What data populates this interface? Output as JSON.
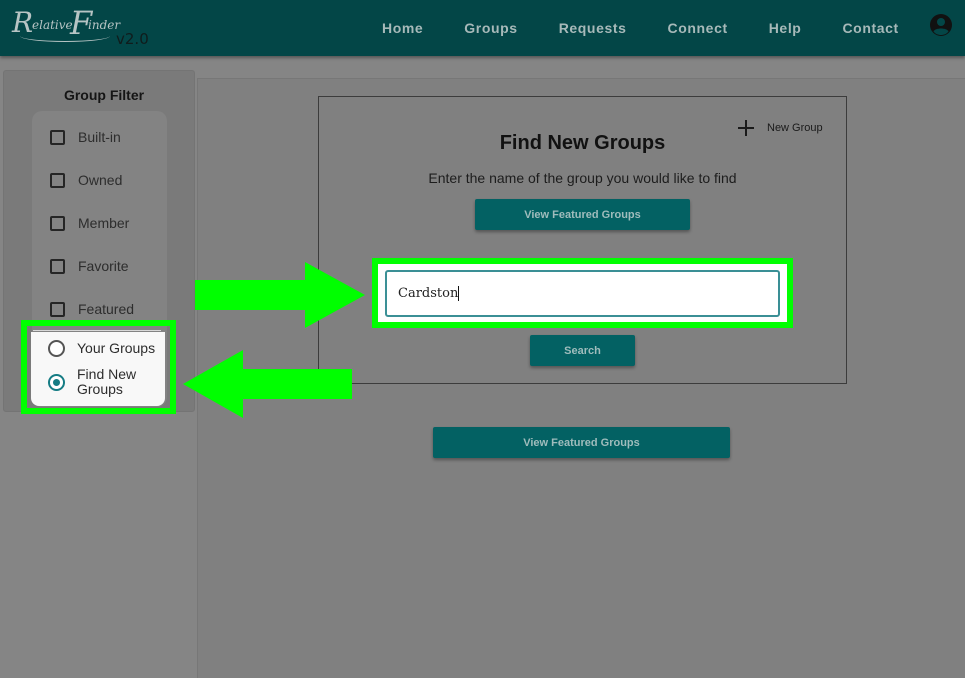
{
  "header": {
    "logo_r": "R",
    "logo_elative": "elative",
    "logo_f": "F",
    "logo_inder": "inder",
    "version": "v2.0",
    "nav": [
      "Home",
      "Groups",
      "Requests",
      "Connect",
      "Help",
      "Contact"
    ],
    "user_icon": "account-circle-icon"
  },
  "sidebar": {
    "title": "Group Filter",
    "checkboxes": [
      "Built-in",
      "Owned",
      "Member",
      "Favorite",
      "Featured"
    ],
    "radios": [
      {
        "label": "Your Groups",
        "checked": false
      },
      {
        "label": "Find New Groups",
        "checked": true
      }
    ]
  },
  "find_card": {
    "title": "Find New Groups",
    "subtitle": "Enter the name of the group you would like to find",
    "new_group_label": "New Group",
    "featured_button": "View Featured Groups",
    "search_value": "Cardston",
    "search_button": "Search"
  },
  "main": {
    "featured_button": "View Featured Groups"
  },
  "annotation_color": "#00ff00",
  "accent_color": "#036163"
}
